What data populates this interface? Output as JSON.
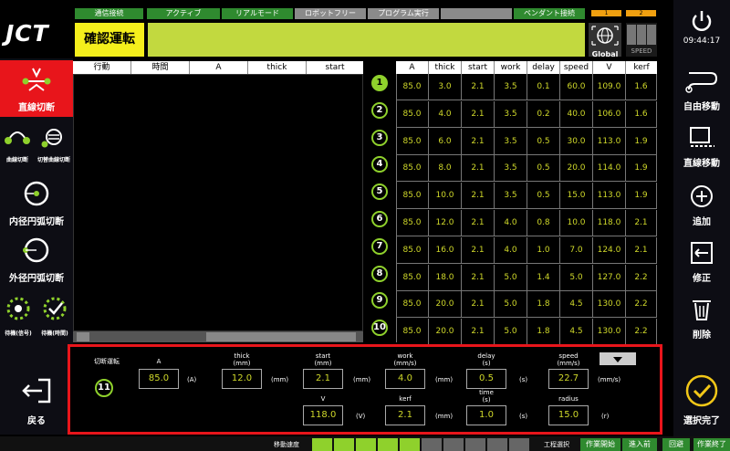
{
  "brand": {
    "logo_text": "JCT"
  },
  "status_chips": [
    "通信接続",
    "アクティブ",
    "リアルモード",
    "ロボットフリー",
    "プログラム実行",
    "",
    "ペンダント接続"
  ],
  "status_small": [
    "1",
    "2"
  ],
  "header": {
    "title": "確認運転",
    "global_label": "Global",
    "speed_label": "SPEED",
    "time": "09:44:17"
  },
  "left_sidebar": {
    "straight_cut": "直線切断",
    "curve_cut": "曲線切断",
    "switch_curve_cut": "切替曲線切断",
    "inner_arc_cut": "内径円弧切断",
    "outer_arc_cut": "外径円弧切断",
    "wait_signal": "待機(信号)",
    "wait_time": "待機(時間)",
    "back": "戻る"
  },
  "right_sidebar": {
    "free_move": "自由移動",
    "straight_move": "直線移動",
    "add": "追加",
    "modify": "修正",
    "delete": "削除",
    "select_done": "選択完了"
  },
  "left_table": {
    "columns": [
      "行動",
      "時間",
      "A",
      "thick",
      "start"
    ]
  },
  "right_table": {
    "columns": [
      "A",
      "thick",
      "start",
      "work",
      "delay",
      "speed",
      "V",
      "kerf"
    ],
    "rows": [
      [
        "85.0",
        "3.0",
        "2.1",
        "3.5",
        "0.1",
        "60.0",
        "109.0",
        "1.6"
      ],
      [
        "85.0",
        "4.0",
        "2.1",
        "3.5",
        "0.2",
        "40.0",
        "106.0",
        "1.6"
      ],
      [
        "85.0",
        "6.0",
        "2.1",
        "3.5",
        "0.5",
        "30.0",
        "113.0",
        "1.9"
      ],
      [
        "85.0",
        "8.0",
        "2.1",
        "3.5",
        "0.5",
        "20.0",
        "114.0",
        "1.9"
      ],
      [
        "85.0",
        "10.0",
        "2.1",
        "3.5",
        "0.5",
        "15.0",
        "113.0",
        "1.9"
      ],
      [
        "85.0",
        "12.0",
        "2.1",
        "4.0",
        "0.8",
        "10.0",
        "118.0",
        "2.1"
      ],
      [
        "85.0",
        "16.0",
        "2.1",
        "4.0",
        "1.0",
        "7.0",
        "124.0",
        "2.1"
      ],
      [
        "85.0",
        "18.0",
        "2.1",
        "5.0",
        "1.4",
        "5.0",
        "127.0",
        "2.2"
      ],
      [
        "85.0",
        "20.0",
        "2.1",
        "5.0",
        "1.8",
        "4.5",
        "130.0",
        "2.2"
      ],
      [
        "85.0",
        "20.0",
        "2.1",
        "5.0",
        "1.8",
        "4.5",
        "130.0",
        "2.2"
      ]
    ],
    "row_numbers": [
      "1",
      "2",
      "3",
      "4",
      "5",
      "6",
      "7",
      "8",
      "9",
      "10"
    ]
  },
  "edit_panel": {
    "mode_label": "切断運転",
    "index": "11",
    "A": {
      "label": "A",
      "value": "85.0",
      "unit": "(A)"
    },
    "thick": {
      "label": "thick\n(mm)",
      "value": "12.0",
      "unit": "(mm)"
    },
    "start": {
      "label": "start\n(mm)",
      "value": "2.1",
      "unit": "(mm)"
    },
    "work": {
      "label": "work\n(mm/s)",
      "value": "4.0",
      "unit": "(mm)"
    },
    "delay": {
      "label": "delay\n(s)",
      "value": "0.5",
      "unit": "(s)"
    },
    "speed": {
      "label": "speed\n(mm/s)",
      "value": "22.7",
      "unit": "(mm/s)"
    },
    "V": {
      "label": "V",
      "value": "118.0",
      "unit": "(V)"
    },
    "kerf": {
      "label": "kerf",
      "value": "2.1",
      "unit": "(mm)"
    },
    "time": {
      "label": "time\n(s)",
      "value": "1.0",
      "unit": "(s)"
    },
    "radius": {
      "label": "radius",
      "value": "15.0",
      "unit": "(r)"
    }
  },
  "bottom_bar": {
    "move_speed_label": "移動速度",
    "process_select_label": "工程選択",
    "work_start": "作業開始",
    "forward": "進入前",
    "retreat": "回避",
    "work_end": "作業終了"
  }
}
